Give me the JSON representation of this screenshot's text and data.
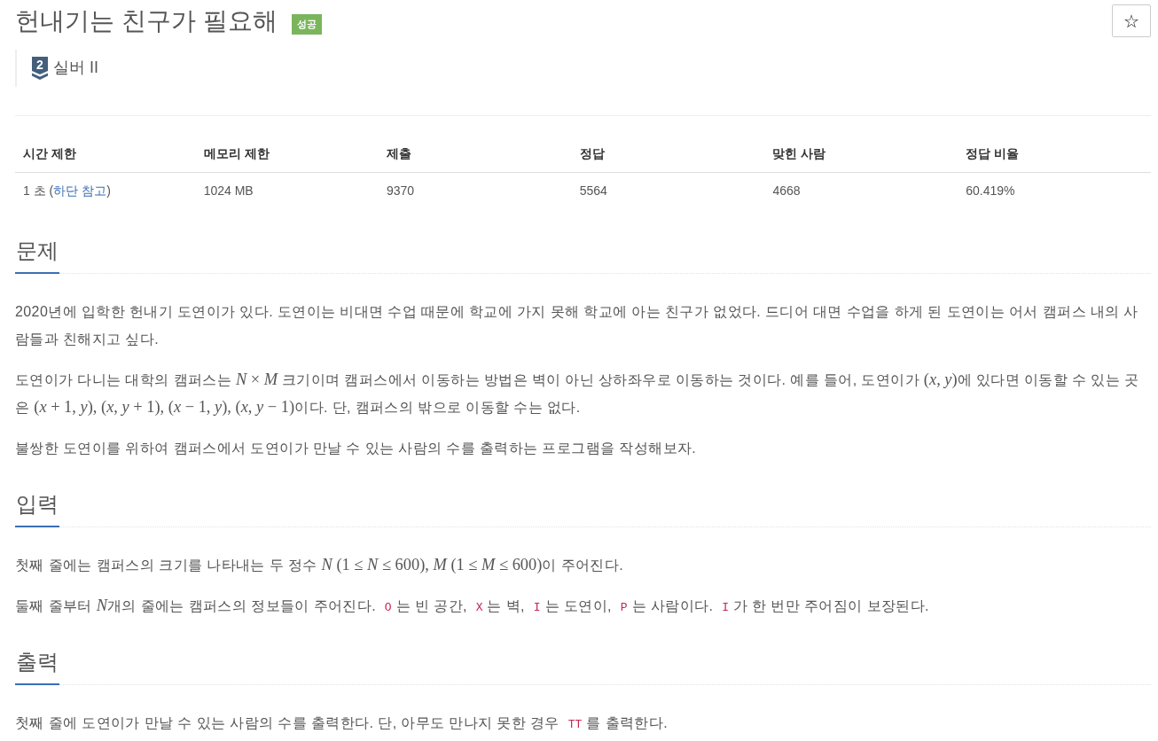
{
  "problem": {
    "title": "헌내기는 친구가 필요해",
    "result_label": "성공"
  },
  "favorite_button": {
    "label": "☆"
  },
  "tier": {
    "number": "2",
    "name": "실버 II"
  },
  "info_table": {
    "columns": [
      "시간 제한",
      "메모리 제한",
      "제출",
      "정답",
      "맞힌 사람",
      "정답 비율"
    ],
    "rows": [
      [
        [
          {
            "kind": "text",
            "text": "1 초 ("
          },
          {
            "kind": "link",
            "text": "하단 참고"
          },
          {
            "kind": "text",
            "text": ")"
          }
        ],
        "1024 MB",
        "9370",
        "5564",
        "4668",
        "60.419%"
      ]
    ]
  },
  "sections": [
    {
      "heading": "문제",
      "paragraphs": [
        [
          {
            "kind": "text",
            "text": "2020년에 입학한 헌내기 도연이가 있다. 도연이는 비대면 수업 때문에 학교에 가지 못해 학교에 아는 친구가 없었다. 드디어 대면 수업을 하게 된 도연이는 어서 캠퍼스 내의 사람들과 친해지고 싶다."
          }
        ],
        [
          {
            "kind": "text",
            "text": "도연이가 다니는 대학의 캠퍼스는 "
          },
          {
            "kind": "math",
            "text": "*N* × *M*"
          },
          {
            "kind": "text",
            "text": " 크기이며 캠퍼스에서 이동하는 방법은 벽이 아닌 상하좌우로 이동하는 것이다. 예를 들어, 도연이가 "
          },
          {
            "kind": "math",
            "text": "(*x*, *y*)"
          },
          {
            "kind": "text",
            "text": "에 있다면 이동할 수 있는 곳은 "
          },
          {
            "kind": "math",
            "text": "(*x* + 1, *y*), (*x*, *y* + 1), (*x* − 1, *y*), (*x*, *y* − 1)"
          },
          {
            "kind": "text",
            "text": "이다. 단, 캠퍼스의 밖으로 이동할 수는 없다."
          }
        ],
        [
          {
            "kind": "text",
            "text": "불쌍한 도연이를 위하여 캠퍼스에서 도연이가 만날 수 있는 사람의 수를 출력하는 프로그램을 작성해보자."
          }
        ]
      ]
    },
    {
      "heading": "입력",
      "paragraphs": [
        [
          {
            "kind": "text",
            "text": "첫째 줄에는 캠퍼스의 크기를 나타내는 두 정수 "
          },
          {
            "kind": "math",
            "text": "*N* (1 ≤ *N* ≤ 600), *M* (1 ≤ *M* ≤ 600)"
          },
          {
            "kind": "text",
            "text": "이 주어진다."
          }
        ],
        [
          {
            "kind": "text",
            "text": "둘째 줄부터 "
          },
          {
            "kind": "math",
            "text": "*N*"
          },
          {
            "kind": "text",
            "text": "개의 줄에는 캠퍼스의 정보들이 주어진다. "
          },
          {
            "kind": "code",
            "text": "O"
          },
          {
            "kind": "text",
            "text": "는 빈 공간, "
          },
          {
            "kind": "code",
            "text": "X"
          },
          {
            "kind": "text",
            "text": "는 벽, "
          },
          {
            "kind": "code",
            "text": "I"
          },
          {
            "kind": "text",
            "text": "는 도연이, "
          },
          {
            "kind": "code",
            "text": "P"
          },
          {
            "kind": "text",
            "text": "는 사람이다. "
          },
          {
            "kind": "code",
            "text": "I"
          },
          {
            "kind": "text",
            "text": "가 한 번만 주어짐이 보장된다."
          }
        ]
      ]
    },
    {
      "heading": "출력",
      "paragraphs": [
        [
          {
            "kind": "text",
            "text": "첫째 줄에 도연이가 만날 수 있는 사람의 수를 출력한다. 단, 아무도 만나지 못한 경우 "
          },
          {
            "kind": "code",
            "text": "TT"
          },
          {
            "kind": "text",
            "text": "를 출력한다."
          }
        ]
      ]
    }
  ]
}
